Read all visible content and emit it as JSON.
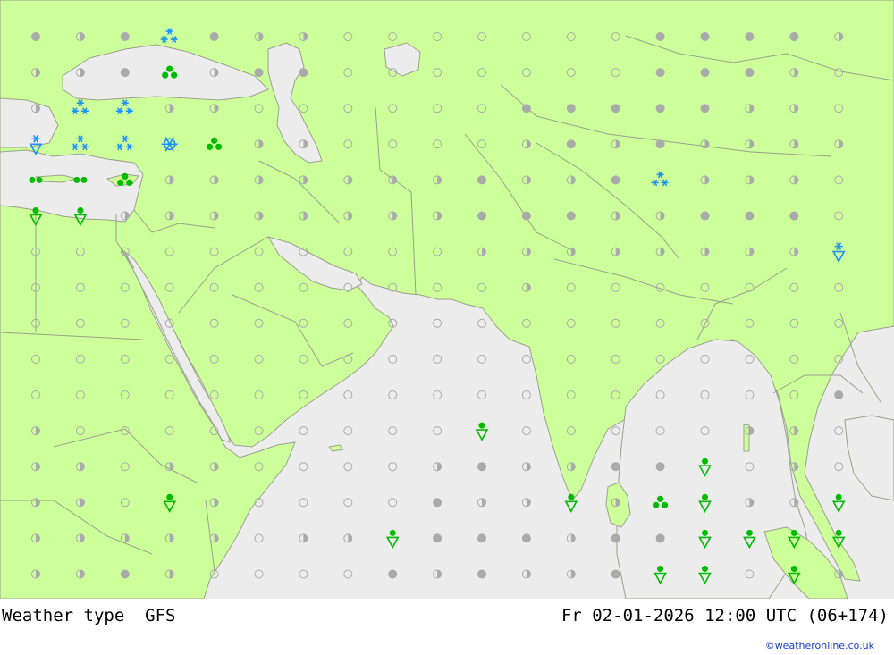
{
  "map": {
    "title": "Weather type",
    "model": "GFS",
    "datetime": "Fr 02-01-2026 12:00 UTC (06+174)",
    "credit": "©weatheronline.co.uk",
    "colors": {
      "land": "#ccff99",
      "sea": "#ececec",
      "border": "#999999",
      "dot": "#aaaaaa",
      "rain": "#00bb00",
      "snow": "#1e90ff"
    },
    "grid": {
      "cols": 19,
      "rows": 16,
      "legend": {
        "o": "clear",
        "h": "partly-cloudy",
        "f": "overcast"
      },
      "data": [
        "fhfhfhhoooooooffffh",
        "hhfhhffooooooofffho",
        "hhhhhoooooofffffhho",
        "hhhhhhhoooohfhfhhhh",
        "hhhhhhhhhhfhhffhhho",
        "hhhhhhhhhhfffhhfffo",
        "oooooooooohhhhhhhhh",
        "ooooooooooohooooooo",
        "ooooooooooooooooooo",
        "ooooooooooooooooooo",
        "oooooooooooooooooof",
        "hooooooooooooooohho",
        "hhohhoooohfhhffhoho",
        "hhoohoooofhhhhhohhh",
        "hhhhhohhofffhffhhhh",
        "hhfhoooofhfhhffhohh"
      ]
    },
    "symbols": [
      {
        "col": 3,
        "row": 0,
        "type": "snow"
      },
      {
        "col": 3,
        "row": 1,
        "type": "showers"
      },
      {
        "col": 1,
        "row": 2,
        "type": "snow"
      },
      {
        "col": 2,
        "row": 2,
        "type": "snow"
      },
      {
        "col": 0,
        "row": 3,
        "type": "snow-shower"
      },
      {
        "col": 1,
        "row": 3,
        "type": "snow"
      },
      {
        "col": 2,
        "row": 3,
        "type": "snow"
      },
      {
        "col": 3,
        "row": 3,
        "type": "heavy-snow"
      },
      {
        "col": 4,
        "row": 3,
        "type": "showers"
      },
      {
        "col": 0,
        "row": 4,
        "type": "rain"
      },
      {
        "col": 1,
        "row": 4,
        "type": "rain"
      },
      {
        "col": 2,
        "row": 4,
        "type": "showers"
      },
      {
        "col": 14,
        "row": 4,
        "type": "snow"
      },
      {
        "col": 0,
        "row": 5,
        "type": "rain-shower"
      },
      {
        "col": 1,
        "row": 5,
        "type": "rain-shower"
      },
      {
        "col": 18,
        "row": 6,
        "type": "snow-shower"
      },
      {
        "col": 10,
        "row": 11,
        "type": "rain-shower"
      },
      {
        "col": 15,
        "row": 12,
        "type": "rain-shower"
      },
      {
        "col": 3,
        "row": 13,
        "type": "rain-shower"
      },
      {
        "col": 12,
        "row": 13,
        "type": "rain-shower"
      },
      {
        "col": 14,
        "row": 13,
        "type": "showers"
      },
      {
        "col": 15,
        "row": 13,
        "type": "rain-shower"
      },
      {
        "col": 18,
        "row": 13,
        "type": "rain-shower"
      },
      {
        "col": 8,
        "row": 14,
        "type": "rain-shower"
      },
      {
        "col": 15,
        "row": 14,
        "type": "rain-shower"
      },
      {
        "col": 16,
        "row": 14,
        "type": "rain-shower"
      },
      {
        "col": 17,
        "row": 14,
        "type": "rain-shower"
      },
      {
        "col": 18,
        "row": 14,
        "type": "rain-shower"
      },
      {
        "col": 14,
        "row": 15,
        "type": "rain-shower"
      },
      {
        "col": 15,
        "row": 15,
        "type": "rain-shower"
      },
      {
        "col": 17,
        "row": 15,
        "type": "rain-shower"
      }
    ]
  }
}
